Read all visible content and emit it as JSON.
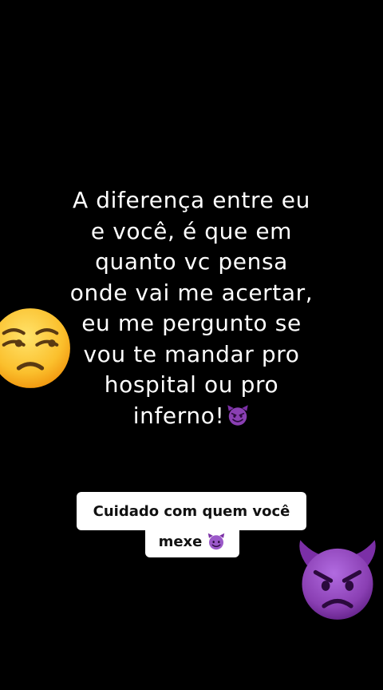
{
  "post": {
    "main_text": "A diferença entre eu\ne você, é que em\nquanto vc pensa\nonde vai me acertar,\neu me pergunto se\nvou te mandar pro\nhospital ou pro\ninferno!",
    "caption_line1": "Cuidado com quem você",
    "caption_line2": "mexe"
  },
  "icons": {
    "inline_emoji": "smiling-devil-icon",
    "left_emoji": "unamused-face-icon",
    "right_emoji": "angry-devil-icon",
    "caption_emoji": "smiling-devil-icon"
  },
  "colors": {
    "background": "#000000",
    "text": "#ffffff",
    "caption_bg": "#ffffff",
    "caption_text": "#111111",
    "devil_purple": "#8a3fb3"
  }
}
